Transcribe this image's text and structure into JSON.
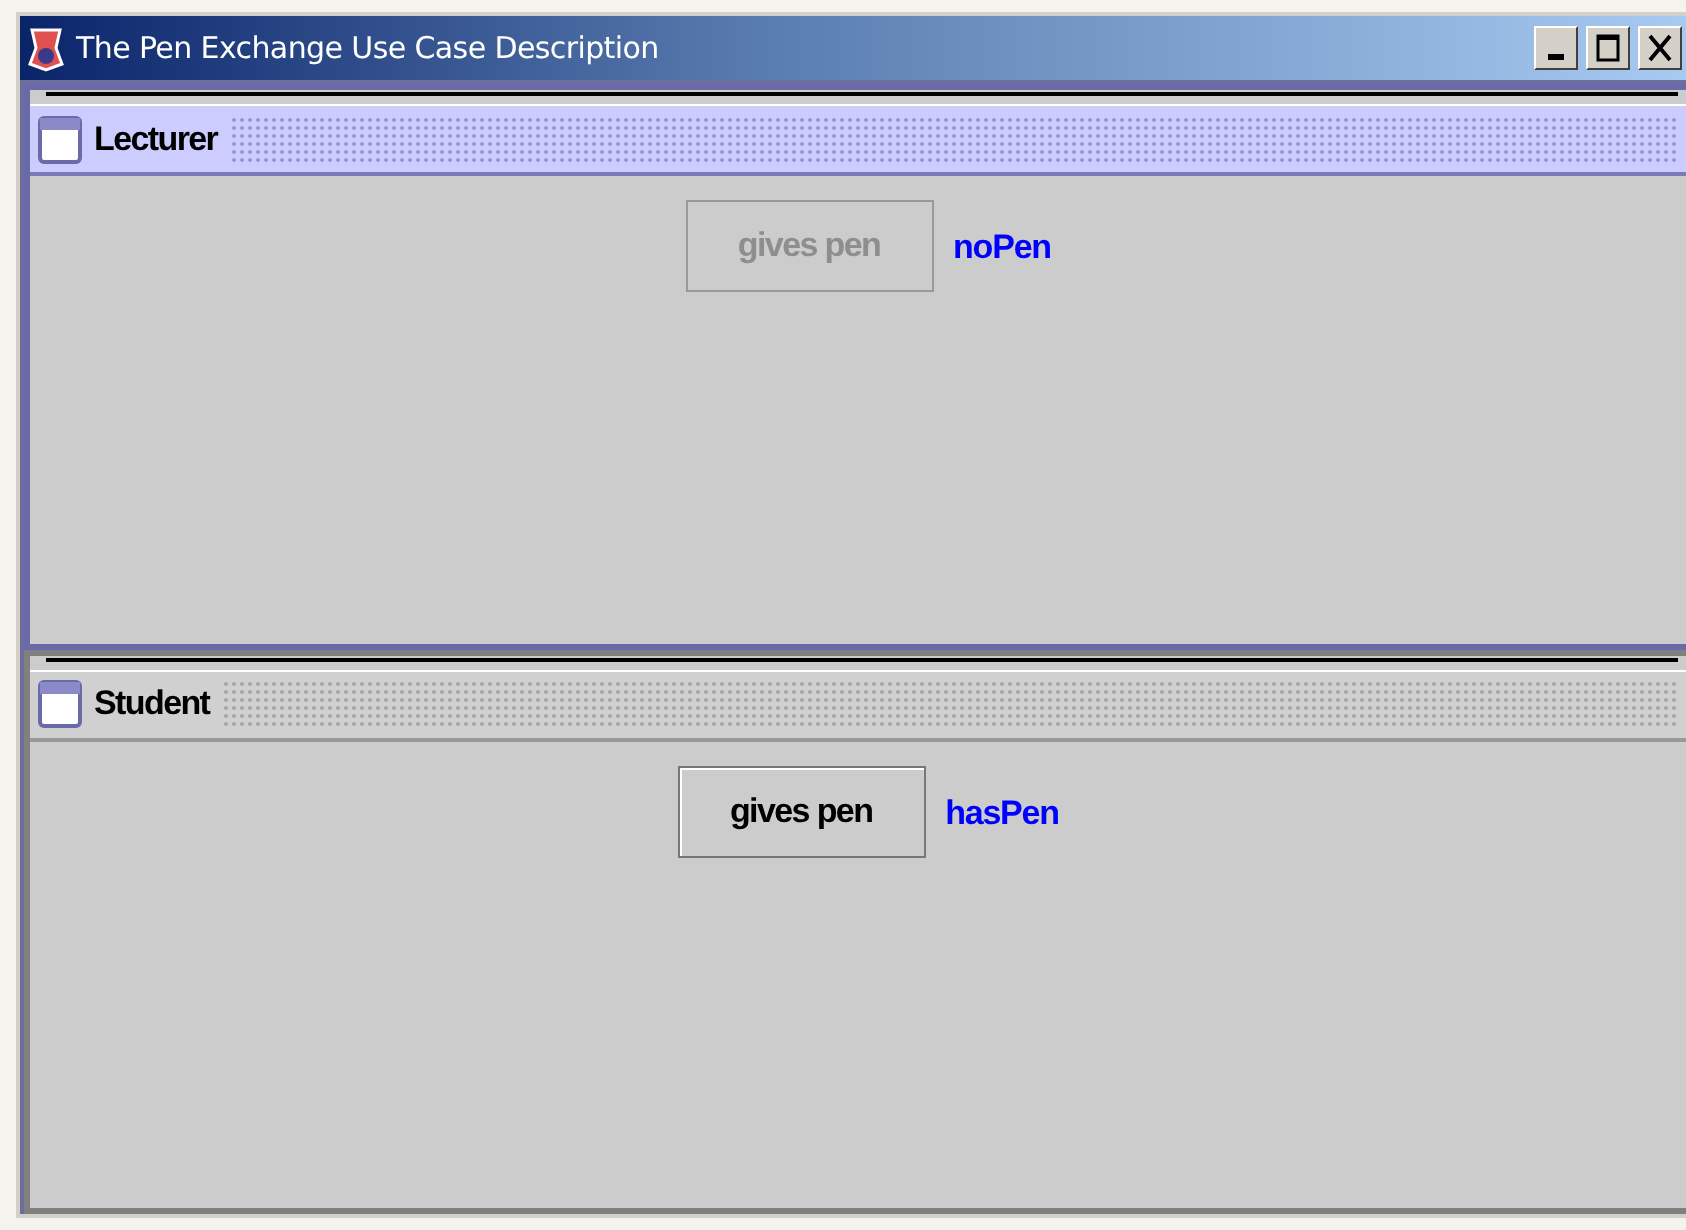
{
  "window": {
    "title": "The Pen Exchange Use Case Description"
  },
  "frames": [
    {
      "title": "Lecturer",
      "active": true,
      "button": {
        "label": "gives pen",
        "disabled": true
      },
      "status": "noPen"
    },
    {
      "title": "Student",
      "active": false,
      "button": {
        "label": "gives pen",
        "disabled": false
      },
      "status": "hasPen"
    }
  ]
}
